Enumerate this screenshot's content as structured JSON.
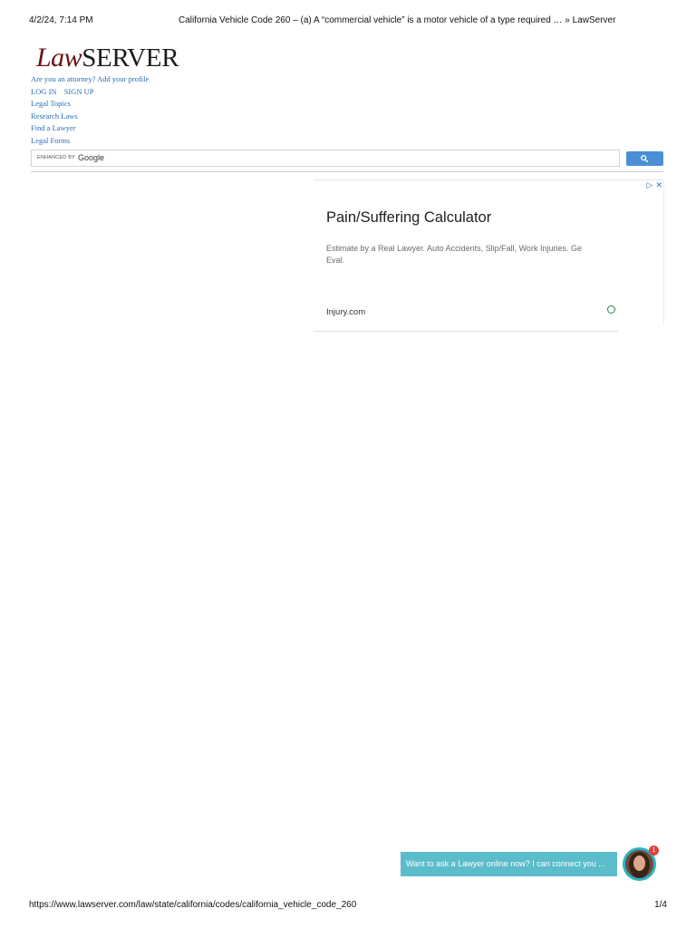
{
  "print_header": {
    "date": "4/2/24, 7:14 PM",
    "title": "California Vehicle Code 260 – (a) A “commercial vehicle” is a motor vehicle of a type required … » LawServer"
  },
  "logo": {
    "law": "Law",
    "server": "SERVER"
  },
  "nav": {
    "attorney_link": "Are you an attorney? Add your profile",
    "login": "LOG IN",
    "signup": "SIGN UP",
    "legal_topics": "Legal Topics",
    "research_laws": "Research Laws",
    "find_lawyer": "Find a Lawyer",
    "legal_forms": "Legal Forms"
  },
  "search": {
    "enhanced_label": "ENHANCED BY",
    "google_label": "Google",
    "button_icon": "search-icon"
  },
  "ad": {
    "adchoices_icon": "adchoices-icon",
    "close_icon": "close-icon",
    "headline": "Pain/Suffering Calculator",
    "description": "Estimate by a Real Lawyer. Auto Accidents, Slip/Fall, Work Injuries. Ge\nEval.",
    "domain": "Injury.com",
    "open_icon": "open-circle-icon"
  },
  "chat": {
    "message": "Want to ask a Lawyer online now? I can connect you ...",
    "notification_count": "1"
  },
  "print_footer": {
    "url": "https://www.lawserver.com/law/state/california/codes/california_vehicle_code_260",
    "page": "1/4"
  },
  "colors": {
    "link": "#2a6db5",
    "logo_law": "#6b1414",
    "search_button": "#4a8fd6",
    "chat_bubble": "#5bbccb",
    "notification": "#e0413a"
  }
}
